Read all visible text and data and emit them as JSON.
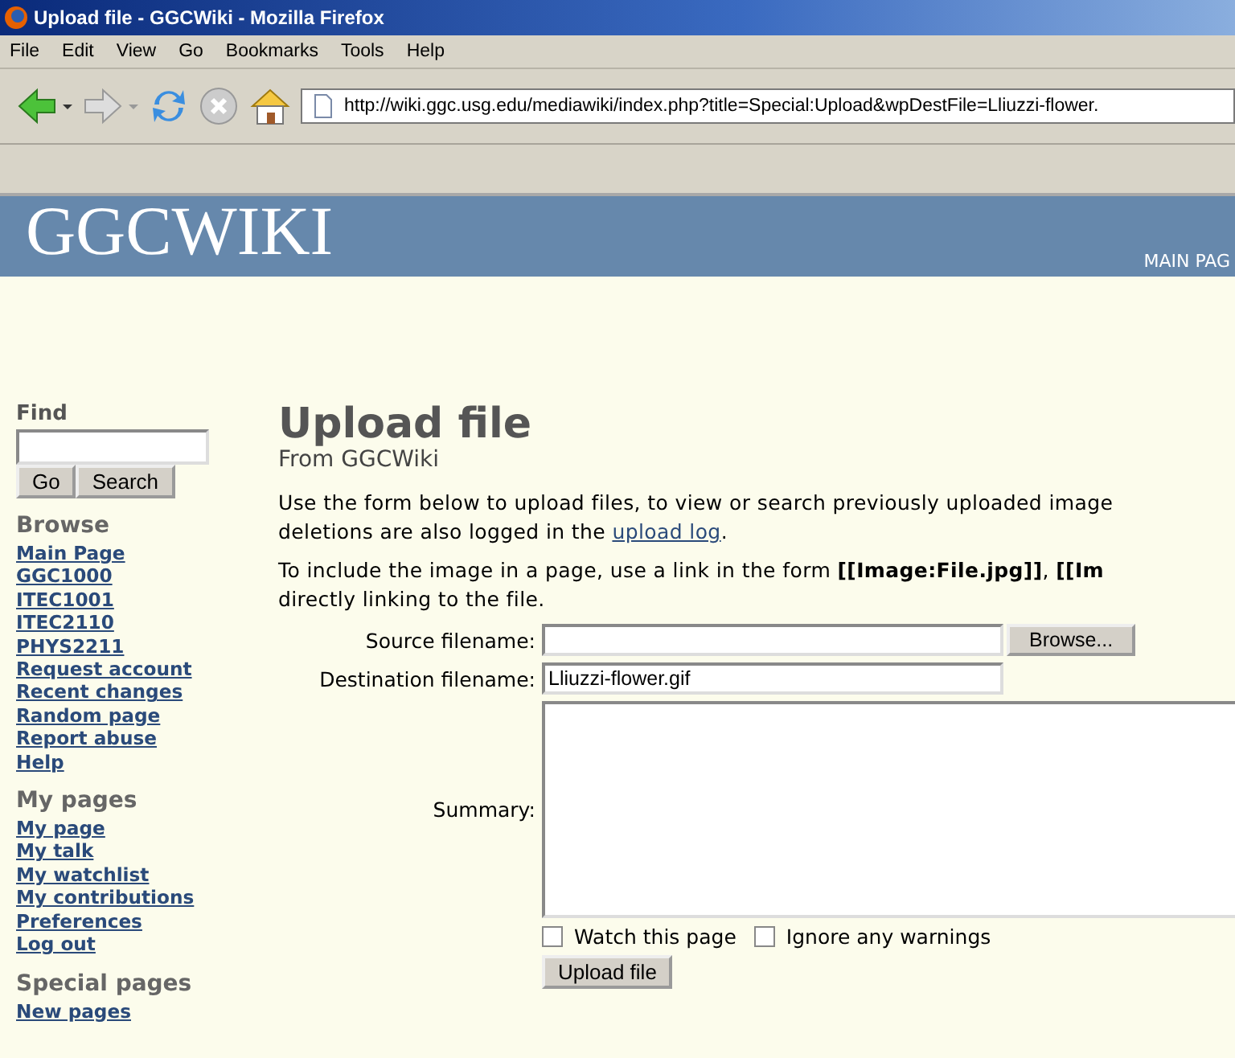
{
  "window": {
    "title": "Upload file - GGCWiki - Mozilla Firefox"
  },
  "menu": [
    "File",
    "Edit",
    "View",
    "Go",
    "Bookmarks",
    "Tools",
    "Help"
  ],
  "address_bar": {
    "value": "http://wiki.ggc.usg.edu/mediawiki/index.php?title=Special:Upload&wpDestFile=Lliuzzi-flower."
  },
  "header": {
    "logo": "GGCWIKI",
    "nav": "MAIN PAG"
  },
  "sidebar": {
    "find_label": "Find",
    "buttons": [
      "Go",
      "Search"
    ],
    "sections": [
      {
        "title": "Browse",
        "links": [
          "Main Page",
          "GGC1000",
          "ITEC1001",
          "ITEC2110",
          "PHYS2211",
          "Request account",
          "Recent changes",
          "Random page",
          "Report abuse",
          "Help"
        ]
      },
      {
        "title": "My pages",
        "links": [
          "My page",
          "My talk",
          "My watchlist",
          "My contributions",
          "Preferences",
          "Log out"
        ]
      },
      {
        "title": "Special pages",
        "links": [
          "New pages"
        ]
      }
    ]
  },
  "content": {
    "title": "Upload file",
    "subtitle": "From GGCWiki",
    "intro": [
      "Use the form below to upload files, to view or search previously uploaded image",
      "deletions are also logged in the "
    ],
    "intro_link": "upload log",
    "intro_end": ".",
    "help": [
      "To include the image in a page, use a link in the form **[[Image:File.jpg]]**, **[[Im**",
      "directly linking to the file."
    ],
    "form": {
      "source_label": "Source filename:",
      "browse": "Browse...",
      "dest_label": "Destination filename:",
      "dest_value": "Lliuzzi-flower.gif",
      "summary_label": "Summary:",
      "checkboxes": [
        {
          "label": "Watch this page",
          "checked": false
        },
        {
          "label": "Ignore any warnings",
          "checked": false
        }
      ],
      "submit": "Upload file"
    }
  }
}
